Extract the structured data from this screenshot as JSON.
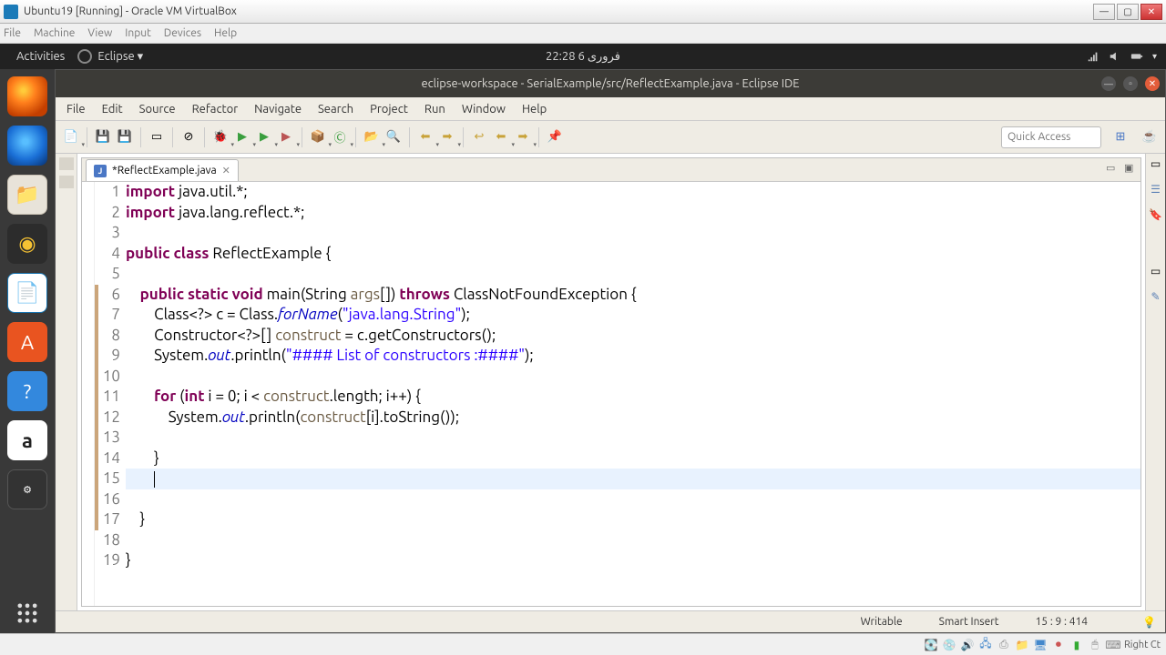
{
  "vbox": {
    "title": "Ubuntu19 [Running] - Oracle VM VirtualBox",
    "menu": [
      "File",
      "Machine",
      "View",
      "Input",
      "Devices",
      "Help"
    ],
    "win": {
      "min": "—",
      "max": "▢",
      "close": "✕"
    }
  },
  "gnome": {
    "activities": "Activities",
    "app": "Eclipse ▾",
    "clock": "فروری 6  22:28"
  },
  "dock": {
    "firefox": "firefox",
    "tb": "thunderbird",
    "files": "files",
    "rhythm": "rhythmbox",
    "writer": "writer",
    "software": "software",
    "help": "help",
    "amazon": "a",
    "javaee": "JavaEE",
    "apps": "apps"
  },
  "eclipse": {
    "title": "eclipse-workspace - SerialExample/src/ReflectExample.java - Eclipse IDE",
    "menu": [
      "File",
      "Edit",
      "Source",
      "Refactor",
      "Navigate",
      "Search",
      "Project",
      "Run",
      "Window",
      "Help"
    ],
    "quick": "Quick Access",
    "tab": "*ReflectExample.java",
    "status": {
      "writable": "Writable",
      "insert": "Smart Insert",
      "pos": "15 : 9 : 414"
    }
  },
  "code": {
    "lines": [
      {
        "n": 1,
        "seg": [
          {
            "t": "import",
            "c": "kw"
          },
          {
            "t": " java.util.*;"
          }
        ]
      },
      {
        "n": 2,
        "seg": [
          {
            "t": "import",
            "c": "kw"
          },
          {
            "t": " java.lang.reflect.*;"
          }
        ]
      },
      {
        "n": 3,
        "seg": [
          {
            "t": ""
          }
        ]
      },
      {
        "n": 4,
        "seg": [
          {
            "t": "public",
            "c": "kw"
          },
          {
            "t": " "
          },
          {
            "t": "class",
            "c": "kw"
          },
          {
            "t": " ReflectExample {"
          }
        ]
      },
      {
        "n": 5,
        "seg": [
          {
            "t": ""
          }
        ]
      },
      {
        "n": 6,
        "seg": [
          {
            "t": "    "
          },
          {
            "t": "public",
            "c": "kw"
          },
          {
            "t": " "
          },
          {
            "t": "static",
            "c": "kw"
          },
          {
            "t": " "
          },
          {
            "t": "void",
            "c": "kw"
          },
          {
            "t": " main(String "
          },
          {
            "t": "args",
            "c": "param"
          },
          {
            "t": "[]) "
          },
          {
            "t": "throws",
            "c": "kw"
          },
          {
            "t": " ClassNotFoundException {"
          }
        ]
      },
      {
        "n": 7,
        "seg": [
          {
            "t": "        Class<?> c = Class."
          },
          {
            "t": "forName",
            "c": "field"
          },
          {
            "t": "("
          },
          {
            "t": "\"java.lang.String\"",
            "c": "str"
          },
          {
            "t": ");"
          }
        ]
      },
      {
        "n": 8,
        "seg": [
          {
            "t": "        Constructor<?>[] "
          },
          {
            "t": "construct",
            "c": "param"
          },
          {
            "t": " = c.getConstructors();"
          }
        ]
      },
      {
        "n": 9,
        "seg": [
          {
            "t": "        System."
          },
          {
            "t": "out",
            "c": "field"
          },
          {
            "t": ".println("
          },
          {
            "t": "\"#### List of constructors :####\"",
            "c": "str"
          },
          {
            "t": ");"
          }
        ]
      },
      {
        "n": 10,
        "seg": [
          {
            "t": ""
          }
        ]
      },
      {
        "n": 11,
        "seg": [
          {
            "t": "        "
          },
          {
            "t": "for",
            "c": "kw"
          },
          {
            "t": " ("
          },
          {
            "t": "int",
            "c": "kw"
          },
          {
            "t": " i = 0; i < "
          },
          {
            "t": "construct",
            "c": "param"
          },
          {
            "t": ".length; i++) {"
          }
        ]
      },
      {
        "n": 12,
        "seg": [
          {
            "t": "            System."
          },
          {
            "t": "out",
            "c": "field"
          },
          {
            "t": ".println("
          },
          {
            "t": "construct",
            "c": "param"
          },
          {
            "t": "[i].toString());"
          }
        ]
      },
      {
        "n": 13,
        "seg": [
          {
            "t": ""
          }
        ]
      },
      {
        "n": 14,
        "seg": [
          {
            "t": "        }"
          }
        ]
      },
      {
        "n": 15,
        "seg": [
          {
            "t": "        "
          }
        ],
        "cursor": true
      },
      {
        "n": 16,
        "seg": [
          {
            "t": ""
          }
        ]
      },
      {
        "n": 17,
        "seg": [
          {
            "t": "    }"
          }
        ]
      },
      {
        "n": 18,
        "seg": [
          {
            "t": ""
          }
        ]
      },
      {
        "n": 19,
        "seg": [
          {
            "t": "}"
          }
        ]
      }
    ]
  },
  "host_status": {
    "right": "Right Ct"
  }
}
